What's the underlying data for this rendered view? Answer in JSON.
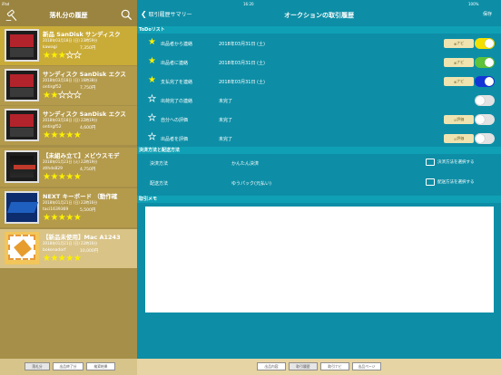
{
  "status": {
    "carrier": "iPad",
    "time": "16:20",
    "battery": "100%"
  },
  "left": {
    "title": "落札分の履歴",
    "tabs": [
      "落札分",
      "出品終了分",
      "検索結果"
    ]
  },
  "items": [
    {
      "title": "新品 SanDisk サンディスク",
      "date": "2018年03月18日 (日) 23時59分",
      "user": "kawagi",
      "price": "7,350円"
    },
    {
      "title": "サンディスク SanDisk エクス",
      "date": "2018年03月18日 (日) 16時38分",
      "user": "ontirgf52",
      "price": "7,750円"
    },
    {
      "title": "サンディスク SanDisk エクス",
      "date": "2018年03月18日 (日) 22時19分",
      "user": "ontirgf52",
      "price": "4,600円"
    },
    {
      "title": "【未組み立て】メビウスモデ",
      "date": "2018年01月23日 (火) 22時19分",
      "user": "ztlhds829",
      "price": "4,750円"
    },
    {
      "title": "NEXT キーボード （動作確",
      "date": "2018年01月21日 (日) 22時16分",
      "user": "taci1639369",
      "price": "5,500円"
    },
    {
      "title": "【新品未使用】Mac A1243",
      "date": "2018年01月21日 (日) 22時16分",
      "user": "bokenadorf",
      "price": "10,000円"
    }
  ],
  "right": {
    "back": "取引履歴サマリー",
    "title": "オークションの取引履歴",
    "save": "保存",
    "todo_header": "ToDoリスト",
    "payment_header": "決済方法と配送方法",
    "memo_header": "取引メモ",
    "tabs": [
      "出品内容",
      "取引履歴",
      "取引ナビ",
      "出品ページ"
    ]
  },
  "todo": [
    {
      "label": "出品者から連絡",
      "value": "2018年03月31日 (土)",
      "button": "ナビ"
    },
    {
      "label": "出品者に連絡",
      "value": "2018年03月31日 (土)",
      "button": "ナビ"
    },
    {
      "label": "支払完了を連絡",
      "value": "2018年03月31日 (土)",
      "button": "ナビ"
    },
    {
      "label": "出荷完了の連絡",
      "value": "未完了"
    },
    {
      "label": "自分への評価",
      "value": "未完了",
      "button": "評価"
    },
    {
      "label": "出品者を評価",
      "value": "未完了",
      "button": "評価"
    }
  ],
  "payment": [
    {
      "label": "決済方法",
      "value": "かんたん決済",
      "button": "決済方法を選択する"
    },
    {
      "label": "配送方法",
      "value": "ゆうパック(元払い)",
      "button": "配送方法を選択する"
    }
  ]
}
